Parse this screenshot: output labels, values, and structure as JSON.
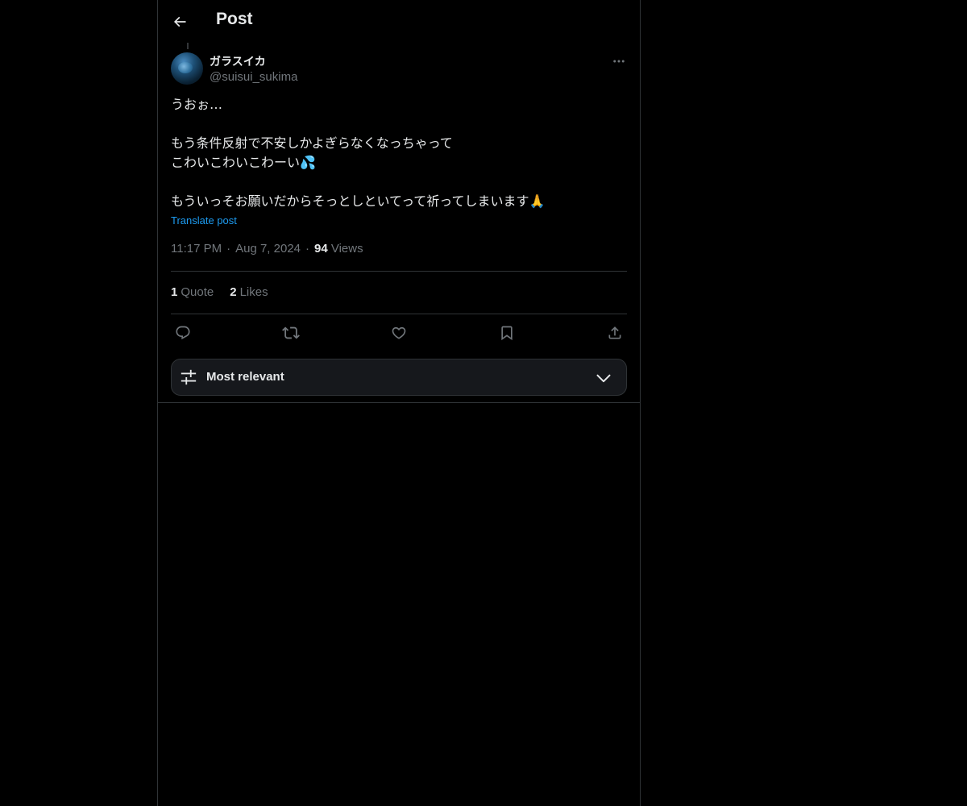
{
  "header": {
    "title": "Post",
    "back_icon": "arrow-left-icon"
  },
  "post": {
    "author_name": "ガラスイカ",
    "author_handle": "@suisui_sukima",
    "more_icon": "more-horizontal-icon",
    "text": "うおぉ…\n\nもう条件反射で不安しかよぎらなくなっちゃって\nこわいこわいこわーい💦\n\nもういっそお願いだからそっとしといてって祈ってしまいます🙏",
    "translate_label": "Translate post",
    "time": "11:17 PM",
    "date": "Aug 7, 2024",
    "views_count": "94",
    "views_label": "Views",
    "separator": "·"
  },
  "stats": {
    "quote_count": "1",
    "quote_label": "Quote",
    "likes_count": "2",
    "likes_label": "Likes"
  },
  "actions": {
    "reply_icon": "reply-icon",
    "repost_icon": "repost-icon",
    "like_icon": "heart-icon",
    "bookmark_icon": "bookmark-icon",
    "share_icon": "share-icon"
  },
  "sort": {
    "label": "Most relevant",
    "icon": "sliders-icon",
    "chevron_icon": "chevron-down-icon"
  },
  "colors": {
    "background": "#000000",
    "text": "#e7e9ea",
    "muted": "#71767b",
    "link": "#1d9bf0",
    "border": "#2f3336"
  }
}
